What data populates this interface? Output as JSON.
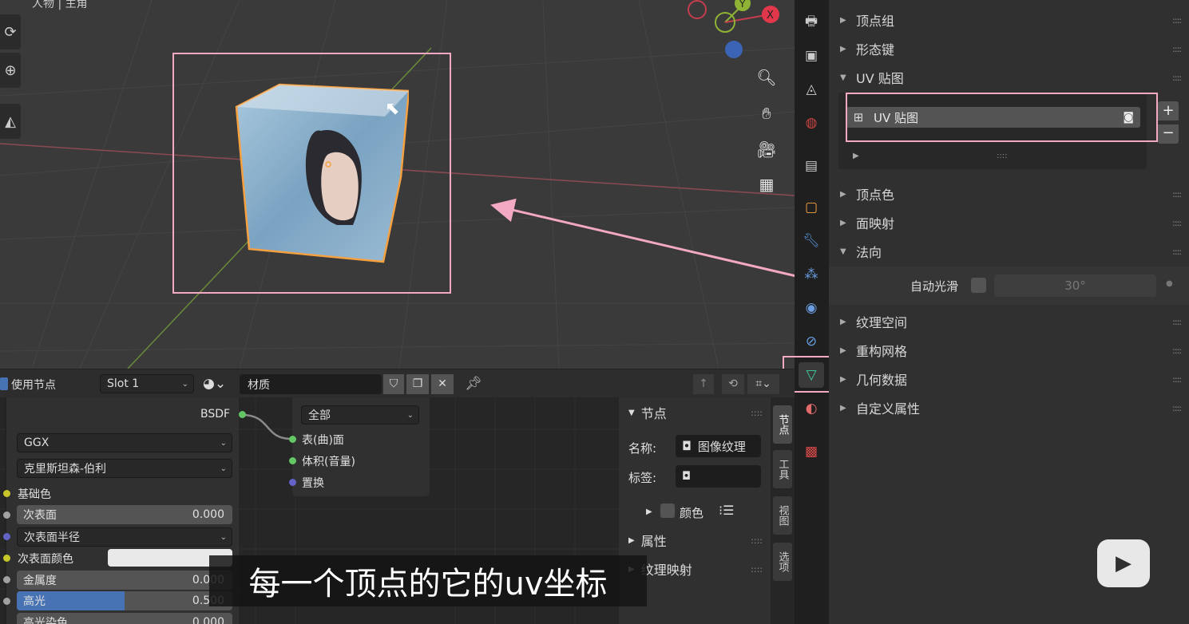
{
  "viewport": {
    "header_partial": "人物 | 主角",
    "gizmo": {
      "y_label": "Y",
      "x_label": "X"
    }
  },
  "properties": {
    "sections": [
      {
        "label": "顶点组",
        "expanded": false
      },
      {
        "label": "形态键",
        "expanded": false
      },
      {
        "label": "UV 贴图",
        "expanded": true
      },
      {
        "label": "顶点色",
        "expanded": false
      },
      {
        "label": "面映射",
        "expanded": false
      },
      {
        "label": "法向",
        "expanded": true
      },
      {
        "label": "纹理空间",
        "expanded": false
      },
      {
        "label": "重构网格",
        "expanded": false
      },
      {
        "label": "几何数据",
        "expanded": false
      },
      {
        "label": "自定义属性",
        "expanded": false
      }
    ],
    "uv_map_item": "UV 贴图",
    "auto_smooth_label": "自动光滑",
    "auto_smooth_angle": "30°",
    "add_label": "+",
    "remove_label": "−"
  },
  "node_header": {
    "use_nodes_label": "使用节点",
    "slot": "Slot 1",
    "material_name": "材质"
  },
  "bsdf_node": {
    "output_label": "BSDF",
    "distribution": "GGX",
    "subsurface_method": "克里斯坦森-伯利",
    "base_color_label": "基础色",
    "subsurface_label": "次表面",
    "subsurface_value": "0.000",
    "subsurface_radius_label": "次表面半径",
    "subsurface_color_label": "次表面颜色",
    "metallic_label": "金属度",
    "metallic_value": "0.000",
    "specular_label": "高光",
    "specular_value": "0.500",
    "specular_fraction": 0.5,
    "specular_tint_label": "高光染色",
    "specular_tint_value": "0.000"
  },
  "output_node": {
    "target": "全部",
    "surface_label": "表(曲)面",
    "volume_label": "体积(音量)",
    "displacement_label": "置换"
  },
  "sidebar": {
    "node_section": "节点",
    "name_label": "名称:",
    "name_value": "图像纹理",
    "tag_label": "标签:",
    "color_label": "颜色",
    "properties_section": "属性",
    "texture_mapping_section": "纹理映射",
    "tabs": [
      "节点",
      "工具",
      "视图",
      "选项"
    ]
  },
  "subtitle": "每一个顶点的它的uv坐标",
  "colors": {
    "highlight": "#f3a8c4",
    "active_tab_green": "#3fd0a0",
    "accent_blue": "#4772b3",
    "selection_orange": "#f5a142"
  }
}
